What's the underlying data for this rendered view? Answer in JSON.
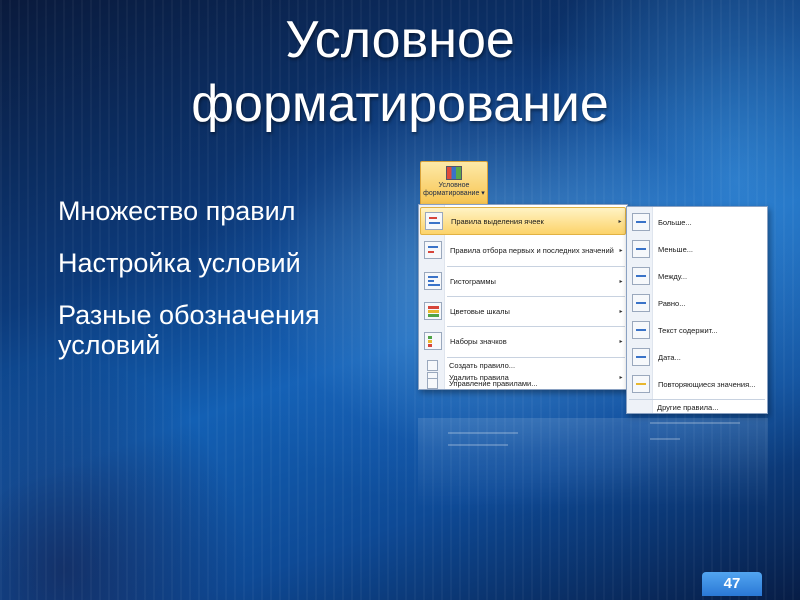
{
  "slide": {
    "title_line1": "Условное",
    "title_line2": "форматирование",
    "page_number": "47"
  },
  "bullets": [
    {
      "marker": "",
      "text": "Множество правил"
    },
    {
      "marker": "",
      "text": "Настройка условий"
    },
    {
      "marker": "",
      "text": "Разные обозначения условий"
    }
  ],
  "ribbon_button": {
    "label_line1": "Условное",
    "label_line2": "форматирование ▾",
    "icon": "conditional-formatting-icon"
  },
  "main_menu": {
    "items": [
      {
        "label": "Правила выделения ячеек",
        "icon": "highlight-rules-icon",
        "has_submenu": true,
        "highlighted": true
      },
      {
        "label": "Правила отбора первых и последних значений",
        "icon": "top-bottom-rules-icon",
        "has_submenu": true
      },
      {
        "label": "Гистограммы",
        "icon": "data-bars-icon",
        "has_submenu": true
      },
      {
        "label": "Цветовые шкалы",
        "icon": "color-scales-icon",
        "has_submenu": true
      },
      {
        "label": "Наборы значков",
        "icon": "icon-sets-icon",
        "has_submenu": true
      }
    ],
    "commands": [
      {
        "label": "Создать правило...",
        "icon": "new-rule-icon"
      },
      {
        "label": "Удалить правила",
        "icon": "clear-rules-icon",
        "has_submenu": true
      },
      {
        "label": "Управление правилами...",
        "icon": "manage-rules-icon"
      }
    ],
    "submenu_arrow": "▸"
  },
  "sub_menu": {
    "items": [
      {
        "label": "Больше...",
        "icon": "greater-than-icon"
      },
      {
        "label": "Меньше...",
        "icon": "less-than-icon"
      },
      {
        "label": "Между...",
        "icon": "between-icon"
      },
      {
        "label": "Равно...",
        "icon": "equal-to-icon"
      },
      {
        "label": "Текст содержит...",
        "icon": "text-contains-icon"
      },
      {
        "label": "Дата...",
        "icon": "date-occurring-icon"
      },
      {
        "label": "Повторяющиеся значения...",
        "icon": "duplicate-values-icon"
      }
    ],
    "more_rules": "Другие правила..."
  },
  "colors": {
    "background_dark": "#0a1a3c",
    "background_light": "#1360b4",
    "highlight": "#fcd36a",
    "page_badge": "#2a78d6"
  }
}
